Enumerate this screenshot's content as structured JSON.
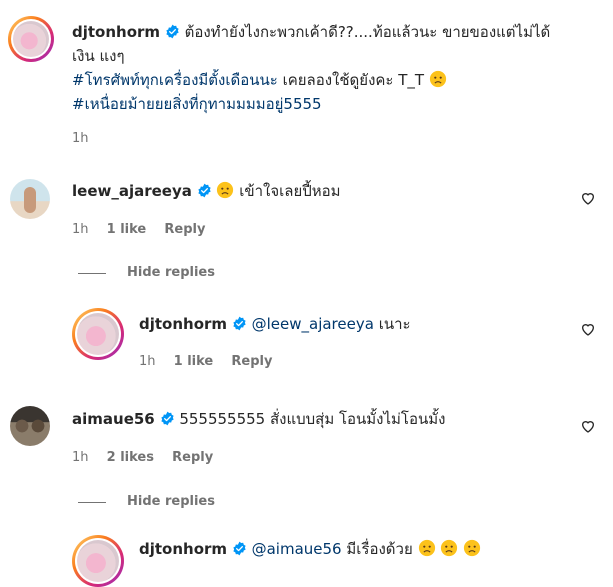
{
  "post_caption": {
    "username": "djtonhorm",
    "line1": "ต้องทำยังไงกะพวกเค้าดี??....ท้อแล้วนะ ขายของแต่ไม่ได้",
    "line2": "เงิน แงๆ",
    "line3_hashtag": "#โทรศัพท์ทุกเครื่องมีตั้งเดือนนะ",
    "line3_text": "เคยลองใช้ดูยังคะ T_T",
    "line4_hashtag": "#เหนื่อยม้ายยยสิ่งที่กุทามมมมอยู่5555",
    "time": "1h"
  },
  "comments": [
    {
      "username": "leew_ajareeya",
      "text": "เข้าใจเลยปี้หอม",
      "time": "1h",
      "likes": "1 like",
      "reply_label": "Reply"
    },
    {
      "username": "djtonhorm",
      "mention": "@leew_ajareeya",
      "text": "เนาะ",
      "time": "1h",
      "likes": "1 like",
      "reply_label": "Reply"
    },
    {
      "username": "aimaue56",
      "text": "555555555 สั่งแบบสุ่ม โอนมั้งไม่โอนมั้ง",
      "time": "1h",
      "likes": "2 likes",
      "reply_label": "Reply"
    },
    {
      "username": "djtonhorm",
      "mention": "@aimaue56",
      "text": "มีเรื่องด้วย"
    }
  ],
  "hide_replies_label": "Hide replies",
  "colors": {
    "verified": "#0095f6",
    "text": "#262626",
    "meta": "#737373",
    "hashtag": "#00376b"
  }
}
